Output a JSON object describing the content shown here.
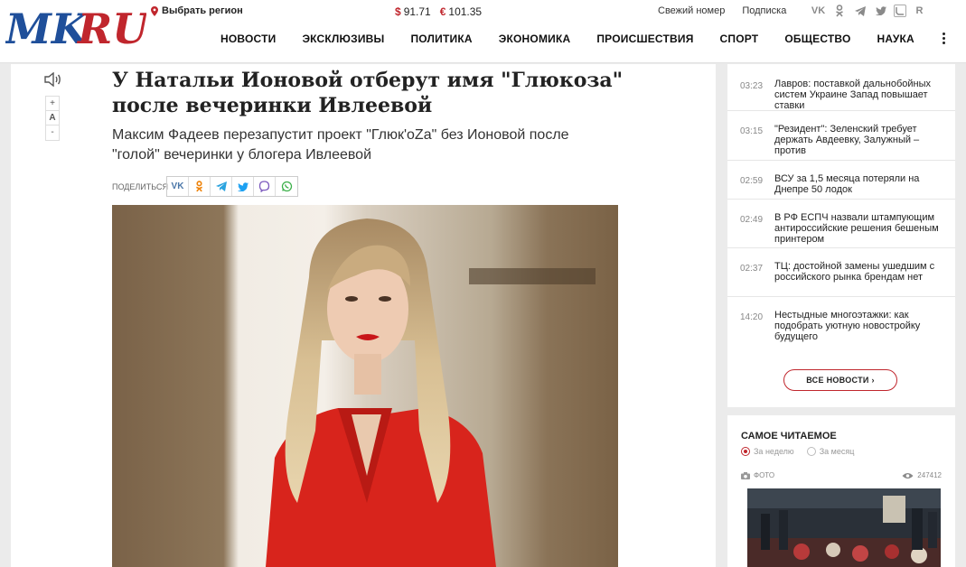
{
  "header": {
    "logo_text": "MKRU",
    "region_label": "Выбрать регион",
    "currency": [
      {
        "symbol": "$",
        "value": "91.71"
      },
      {
        "symbol": "€",
        "value": "101.35"
      }
    ],
    "links": [
      "Свежий номер",
      "Подписка"
    ],
    "social_icons": [
      "vk-icon",
      "ok-icon",
      "telegram-icon",
      "twitter-icon",
      "livejournal-icon",
      "rss-icon"
    ],
    "nav": [
      "НОВОСТИ",
      "ЭКСКЛЮЗИВЫ",
      "ПОЛИТИКА",
      "ЭКОНОМИКА",
      "ПРОИСШЕСТВИЯ",
      "СПОРТ",
      "ОБЩЕСТВО",
      "НАУКА"
    ],
    "brand_color": "#c0262d"
  },
  "article": {
    "title": "У Натальи Ионовой отберут имя \"Глюкоза\" после вечеринки Ивлеевой",
    "subtitle": "Максим Фадеев перезапустит проект \"Глюк'oZa\" без Ионовой после \"голой\" вечеринки у блогера Ивлеевой",
    "share_label": "ПОДЕЛИТЬСЯ",
    "font_controls": [
      "+",
      "A",
      "-"
    ]
  },
  "news": {
    "items": [
      {
        "time": "03:23",
        "text": "Лавров: поставкой дальнобойных систем Украине Запад повышает ставки"
      },
      {
        "time": "03:15",
        "text": "\"Резидент\": Зеленский требует держать Авдеевку, Залужный – против"
      },
      {
        "time": "02:59",
        "text": "ВСУ за 1,5 месяца потеряли на Днепре 50 лодок"
      },
      {
        "time": "02:49",
        "text": "В РФ ЕСПЧ назвали штампующим антироссийские решения бешеным принтером"
      },
      {
        "time": "02:37",
        "text": "ТЦ: достойной замены ушедшим с российского рынка брендам нет"
      },
      {
        "time": "14:20",
        "text": "Нестыдные многоэтажки: как подобрать уютную новостройку будущего"
      }
    ],
    "all_label": "ВСЕ НОВОСТИ ›"
  },
  "most_read": {
    "title": "САМОЕ ЧИТАЕМОЕ",
    "tabs": [
      {
        "label": "За неделю",
        "selected": true
      },
      {
        "label": "За месяц",
        "selected": false
      }
    ],
    "item_type": "ФОТО",
    "views": "247412"
  }
}
